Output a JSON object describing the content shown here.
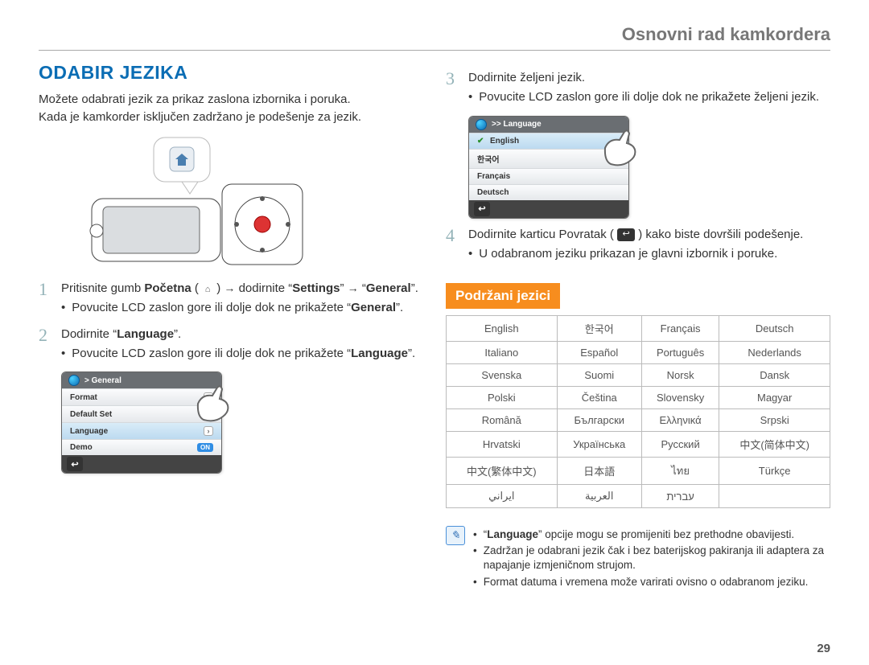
{
  "header": {
    "title": "Osnovni rad kamkordera"
  },
  "pageNumber": "29",
  "section": {
    "title": "ODABIR JEZIKA"
  },
  "intro": {
    "line1": "Možete odabrati jezik za prikaz zaslona izbornika i poruka.",
    "line2": "Kada je kamkorder isključen zadržano je podešenje za jezik."
  },
  "steps_left": {
    "s1_a": "Pritisnite gumb ",
    "s1_b": "Početna",
    "s1_c": " ( ",
    "s1_d": " ) ",
    "s1_arrow": "→",
    "s1_e": " dodirnite “",
    "s1_settings": "Settings",
    "s1_f": "” ",
    "s1_g": " “",
    "s1_general": "General",
    "s1_h": "”.",
    "s1_bullet": "Povucite LCD zaslon gore ili dolje dok ne prikažete “",
    "s1_bullet_general": "General",
    "s1_bullet_end": "”.",
    "s2_a": "Dodirnite “",
    "s2_lang": "Language",
    "s2_b": "”.",
    "s2_bullet_a": "Povucite LCD zaslon gore ili dolje dok ne prikažete “",
    "s2_bullet_lang": "Language",
    "s2_bullet_b": "”."
  },
  "screen_general": {
    "title": "> General",
    "rows": [
      "Format",
      "Default Set",
      "Language",
      "Demo"
    ],
    "on": "ON"
  },
  "steps_right": {
    "s3_a": "Dodirnite željeni jezik.",
    "s3_bullet": "Povucite LCD zaslon gore ili dolje dok ne prikažete željeni jezik.",
    "s4_a": "Dodirnite karticu Povratak ( ",
    "s4_b": " ) kako biste dovršili podešenje.",
    "s4_bullet": "U odabranom jeziku prikazan je glavni izbornik i poruke."
  },
  "screen_language": {
    "title": ">> Language",
    "rows": [
      "English",
      "한국어",
      "Français",
      "Deutsch"
    ]
  },
  "supported": {
    "heading": "Podržani jezici"
  },
  "lang_table": [
    [
      "English",
      "한국어",
      "Français",
      "Deutsch"
    ],
    [
      "Italiano",
      "Español",
      "Português",
      "Nederlands"
    ],
    [
      "Svenska",
      "Suomi",
      "Norsk",
      "Dansk"
    ],
    [
      "Polski",
      "Čeština",
      "Slovensky",
      "Magyar"
    ],
    [
      "Română",
      "Български",
      "Ελληνικά",
      "Srpski"
    ],
    [
      "Hrvatski",
      "Українська",
      "Русский",
      "中文(简体中文)"
    ],
    [
      "中文(繁体中文)",
      "日本語",
      "ไทย",
      "Türkçe"
    ],
    [
      "ايراني",
      "العربية",
      "עברית",
      ""
    ]
  ],
  "notes": {
    "n1_a": "“",
    "n1_b": "Language",
    "n1_c": "” opcije mogu se promijeniti bez prethodne obavijesti.",
    "n2": "Zadržan je odabrani jezik čak i bez baterijskog pakiranja ili adaptera za napajanje izmjeničnom strujom.",
    "n3": "Format datuma i vremena može varirati ovisno o odabranom jeziku."
  }
}
